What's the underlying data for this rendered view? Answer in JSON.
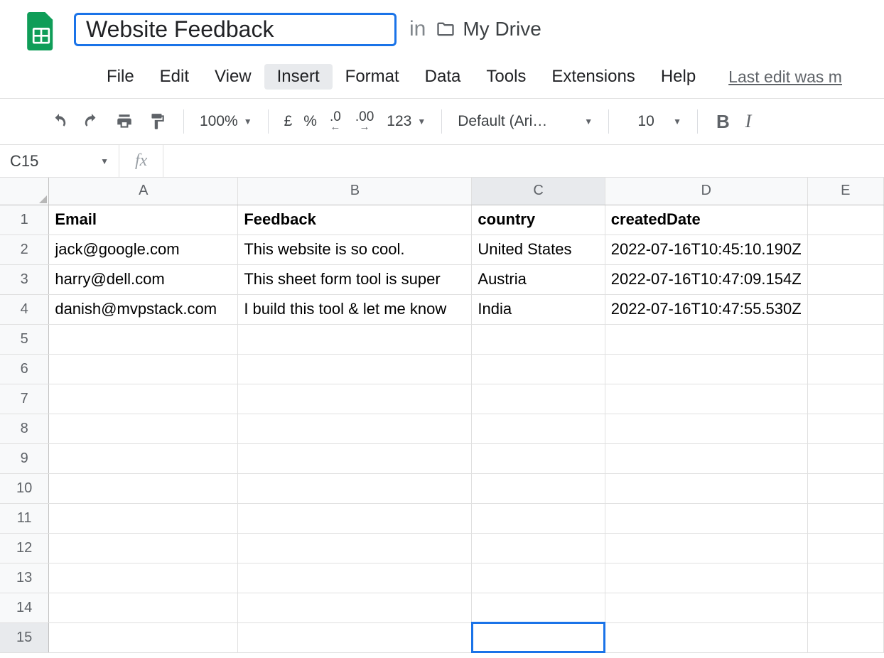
{
  "title": "Website Feedback",
  "in_label": "in",
  "drive_location": "My Drive",
  "menu": {
    "file": "File",
    "edit": "Edit",
    "view": "View",
    "insert": "Insert",
    "format": "Format",
    "data": "Data",
    "tools": "Tools",
    "extensions": "Extensions",
    "help": "Help"
  },
  "last_edit": "Last edit was m",
  "toolbar": {
    "zoom": "100%",
    "currency": "£",
    "percent": "%",
    "dec_dec": ".0",
    "dec_inc": ".00",
    "more_formats": "123",
    "font": "Default (Ari…",
    "font_size": "10"
  },
  "namebox": "C15",
  "fx": "fx",
  "formula_value": "",
  "columns": [
    "A",
    "B",
    "C",
    "D",
    "E"
  ],
  "selected_col": "C",
  "selected_row": 15,
  "row_count": 15,
  "headers": [
    "Email",
    "Feedback",
    "country",
    "createdDate",
    ""
  ],
  "rows": [
    {
      "email": "jack@google.com",
      "feedback": "This website is so cool.",
      "country": "United States",
      "createdDate": "2022-07-16T10:45:10.190Z"
    },
    {
      "email": "harry@dell.com",
      "feedback": "This sheet form tool is super",
      "country": "Austria",
      "createdDate": "2022-07-16T10:47:09.154Z"
    },
    {
      "email": "danish@mvpstack.com",
      "feedback": "I build this tool & let me know",
      "country": "India",
      "createdDate": "2022-07-16T10:47:55.530Z"
    }
  ]
}
